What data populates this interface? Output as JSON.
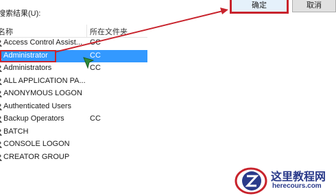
{
  "dialog": {
    "results_label": "搜索结果(U):",
    "ok_label": "确定",
    "cancel_label": "取消"
  },
  "table": {
    "columns": [
      "名称",
      "所在文件夹"
    ],
    "rows": [
      {
        "name": "Access Control Assist...",
        "folder": "CC"
      },
      {
        "name": "Administrator",
        "folder": "CC",
        "selected": true
      },
      {
        "name": "Administrators",
        "folder": "CC"
      },
      {
        "name": "ALL APPLICATION PA...",
        "folder": ""
      },
      {
        "name": "ANONYMOUS LOGON",
        "folder": ""
      },
      {
        "name": "Authenticated Users",
        "folder": ""
      },
      {
        "name": "Backup Operators",
        "folder": "CC"
      },
      {
        "name": "BATCH",
        "folder": ""
      },
      {
        "name": "CONSOLE LOGON",
        "folder": ""
      },
      {
        "name": "CREATOR GROUP",
        "folder": ""
      }
    ]
  },
  "watermark": {
    "title": "这里教程网",
    "url": "herecours.com"
  },
  "colors": {
    "selection": "#3399ff",
    "highlight_red": "#c8232c",
    "watermark_blue": "#2a3a8a"
  }
}
